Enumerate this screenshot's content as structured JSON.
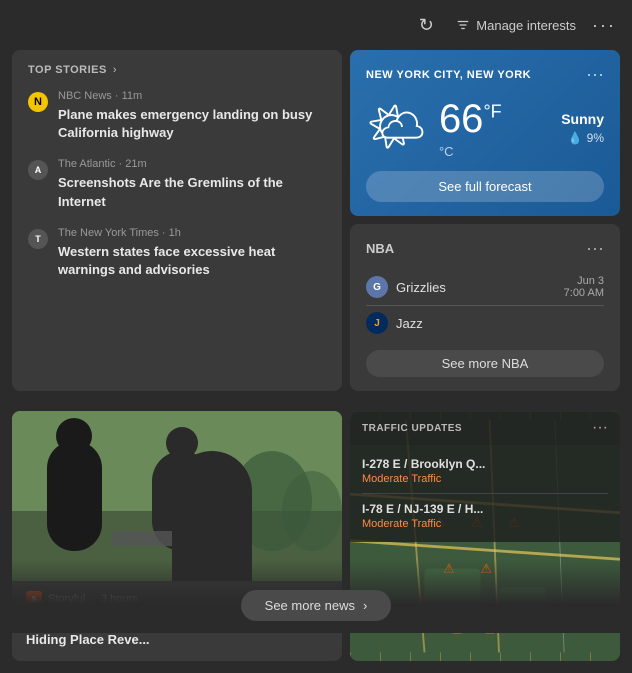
{
  "header": {
    "manage_interests_label": "Manage interests",
    "refresh_title": "Refresh",
    "more_title": "More options"
  },
  "top_stories": {
    "label": "TOP STORIES",
    "chevron": "›",
    "items": [
      {
        "source": "NBC News",
        "time_ago": "11m",
        "title": "Plane makes emergency landing on busy California highway",
        "icon_type": "nbc"
      },
      {
        "source": "The Atlantic",
        "time_ago": "21m",
        "title": "Screenshots Are the Gremlins of the Internet",
        "icon_type": "atlantic"
      },
      {
        "source": "The New York Times",
        "time_ago": "1h",
        "title": "Western states face excessive heat warnings and advisories",
        "icon_type": "nyt"
      }
    ]
  },
  "weather": {
    "city": "NEW YORK CITY, NEW YORK",
    "temp_f": "66",
    "temp_unit_f": "°F",
    "temp_unit_c": "°C",
    "condition": "Sunny",
    "rain_pct": "9%",
    "forecast_btn": "See full forecast",
    "sun_emoji": "🌤"
  },
  "nba": {
    "label": "NBA",
    "teams": [
      {
        "name": "Grizzlies",
        "icon_type": "grizzlies"
      },
      {
        "name": "Jazz",
        "icon_type": "jazz"
      }
    ],
    "date": "Jun 3",
    "time": "7:00 AM",
    "see_more_label": "See more NBA"
  },
  "story": {
    "source": "Storyful",
    "time_ago": "3 hours",
    "title": "Magician's Illusion Exposed as Assistant's Hiding Place Reve..."
  },
  "traffic": {
    "label": "TRAFFIC UPDATES",
    "routes": [
      {
        "name": "I-278 E / Brooklyn Q...",
        "status": "Moderate Traffic"
      },
      {
        "name": "I-78 E / NJ-139 E / H...",
        "status": "Moderate Traffic"
      }
    ]
  },
  "footer": {
    "see_more_news_label": "See more news"
  }
}
